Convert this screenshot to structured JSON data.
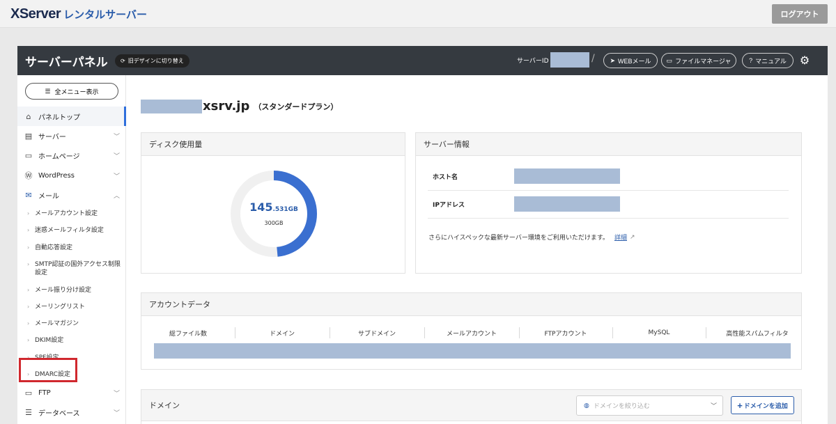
{
  "topbar": {
    "logo_main": "XServer",
    "logo_sub": "レンタルサーバー",
    "logout_label": "ログアウト"
  },
  "header": {
    "title": "サーバーパネル",
    "old_design_label": "旧デザインに切り替え",
    "server_id_label": "サーバーID",
    "separator": "/",
    "webmail_label": "WEBメール",
    "file_manager_label": "ファイルマネージャ",
    "manual_label": "マニュアル"
  },
  "sidebar": {
    "all_menu_label": "全メニュー表示",
    "items": [
      {
        "label": "パネルトップ",
        "icon": "home-icon"
      },
      {
        "label": "サーバー",
        "icon": "server-icon"
      },
      {
        "label": "ホームページ",
        "icon": "window-icon"
      },
      {
        "label": "WordPress",
        "icon": "wordpress-icon"
      },
      {
        "label": "メール",
        "icon": "mail-icon"
      },
      {
        "label": "FTP",
        "icon": "monitor-icon"
      },
      {
        "label": "データベース",
        "icon": "database-icon"
      }
    ],
    "mail_sub": [
      "メールアカウント設定",
      "迷惑メールフィルタ設定",
      "自動応答設定",
      "SMTP認証の国外アクセス制限設定",
      "メール振り分け設定",
      "メーリングリスト",
      "メールマガジン",
      "DKIM設定",
      "SPF設定",
      "DMARC設定"
    ]
  },
  "main": {
    "domain_suffix": "xsrv.jp",
    "plan": "（スタンダードプラン）",
    "disk": {
      "title": "ディスク使用量",
      "used_big": "145",
      "used_small": ".531GB",
      "total": "300GB",
      "used_fraction": 0.485,
      "accent": "#3a6fd0"
    },
    "server_info": {
      "title": "サーバー情報",
      "host_label": "ホスト名",
      "ip_label": "IPアドレス",
      "note": "さらにハイスペックな最新サーバー環境をご利用いただけます。",
      "detail_link": "詳細"
    },
    "account": {
      "title": "アカウントデータ",
      "columns": [
        "総ファイル数",
        "ドメイン",
        "サブドメイン",
        "メールアカウント",
        "FTPアカウント",
        "MySQL",
        "高性能スパムフィルタ"
      ]
    },
    "domain": {
      "title": "ドメイン",
      "filter_placeholder": "ドメインを絞り込む",
      "add_label": "ドメインを追加"
    }
  }
}
